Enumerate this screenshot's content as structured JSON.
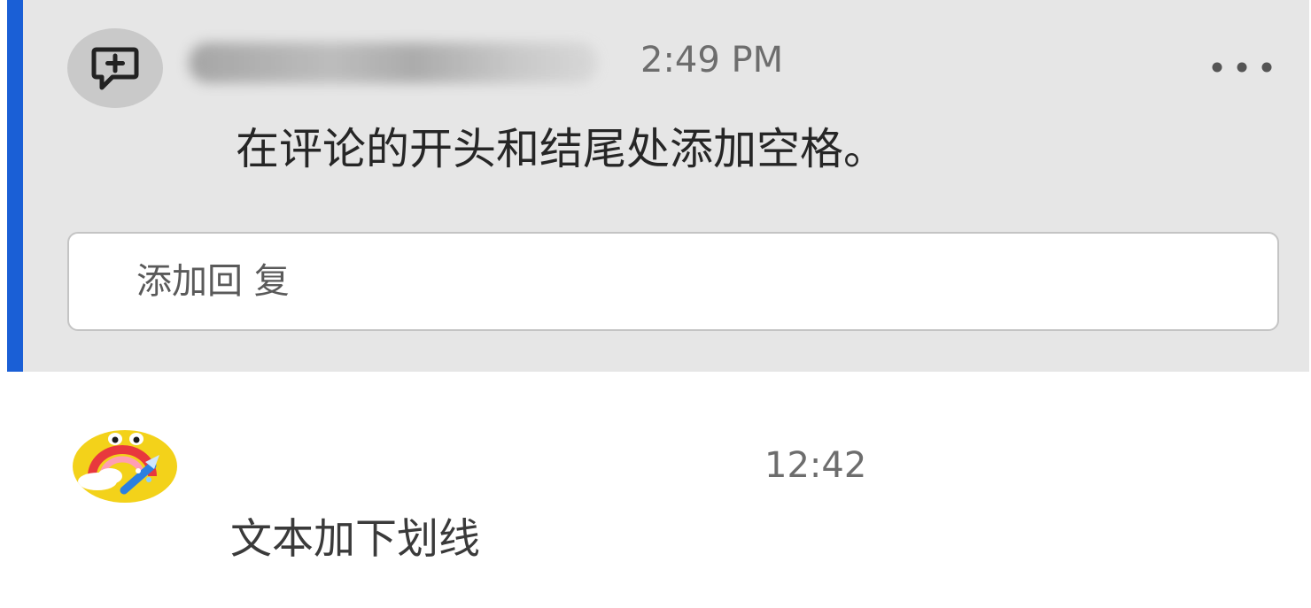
{
  "colors": {
    "card_background": "#e6e6e6",
    "accent": "#1a5fd6",
    "avatar2_background": "#f3d21a"
  },
  "comments": [
    {
      "avatar_icon": "comment-add-icon",
      "author": "",
      "time": "2:49 PM",
      "text": "在评论的开头和结尾处添加空格。",
      "more_icon": "more-horizontal-icon",
      "reply": {
        "placeholder": "添加回 复",
        "value": ""
      }
    },
    {
      "avatar_icon": "rainbow-avatar",
      "time": "12:42",
      "text": "文本加下划线"
    }
  ]
}
